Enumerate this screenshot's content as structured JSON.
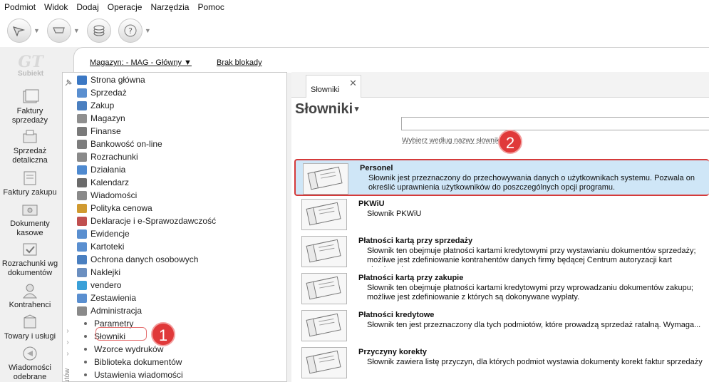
{
  "menubar": {
    "items": [
      "Podmiot",
      "Widok",
      "Dodaj",
      "Operacje",
      "Narzędzia",
      "Pomoc"
    ]
  },
  "toolbar": {
    "buttons": [
      "cursor-icon",
      "cart-icon",
      "coins-icon",
      "help-icon"
    ]
  },
  "logo": {
    "mark": "GT",
    "text": "Subiekt"
  },
  "leftbar": {
    "items": [
      {
        "label": "Faktury sprzedaży",
        "icon": "invoice-stack-icon"
      },
      {
        "label": "Sprzedaż detaliczna",
        "icon": "cash-register-icon"
      },
      {
        "label": "Faktury zakupu",
        "icon": "purchase-invoice-icon"
      },
      {
        "label": "Dokumenty kasowe",
        "icon": "cash-documents-icon"
      },
      {
        "label": "Rozrachunki wg dokumentów",
        "icon": "settlements-icon"
      },
      {
        "label": "Kontrahenci",
        "icon": "person-icon"
      },
      {
        "label": "Towary i usługi",
        "icon": "goods-icon"
      },
      {
        "label": "Wiadomości odebrane",
        "icon": "message-icon"
      }
    ]
  },
  "strip": {
    "magazyn": "Magazyn: - MAG - Główny",
    "blokada": "Brak blokady"
  },
  "nav": {
    "items": [
      {
        "label": "Strona główna",
        "color": "#3b78c4"
      },
      {
        "label": "Sprzedaż",
        "color": "#5a8fd0"
      },
      {
        "label": "Zakup",
        "color": "#4a7fc0"
      },
      {
        "label": "Magazyn",
        "color": "#8f8f8f"
      },
      {
        "label": "Finanse",
        "color": "#7a7a7a"
      },
      {
        "label": "Bankowość on-line",
        "color": "#7d7d7d"
      },
      {
        "label": "Rozrachunki",
        "color": "#8a8a8a"
      },
      {
        "label": "Działania",
        "color": "#4f8ad0"
      },
      {
        "label": "Kalendarz",
        "color": "#6b6b6b"
      },
      {
        "label": "Wiadomości",
        "color": "#8a8a8a"
      },
      {
        "label": "Polityka cenowa",
        "color": "#d09a30"
      },
      {
        "label": "Deklaracje i e-Sprawozdawczość",
        "color": "#c05050"
      },
      {
        "label": "Ewidencje",
        "color": "#5a8fd0"
      },
      {
        "label": "Kartoteki",
        "color": "#5a8fd0"
      },
      {
        "label": "Ochrona danych osobowych",
        "color": "#4a7fc0"
      },
      {
        "label": "Naklejki",
        "color": "#6b8fc0"
      },
      {
        "label": "vendero",
        "color": "#3aa0d8"
      },
      {
        "label": "Zestawienia",
        "color": "#5a8fd0"
      },
      {
        "label": "Administracja",
        "color": "#8a8a8a"
      }
    ],
    "subitems": [
      "Parametry",
      "Słowniki",
      "Wzorce wydruków",
      "Biblioteka dokumentów",
      "Ustawienia wiadomości"
    ],
    "vertical_label": "utów"
  },
  "content": {
    "tab_label": "Słowniki",
    "title": "Słowniki",
    "search_hint": "Wybierz według nazwy słownika",
    "rows": [
      {
        "title": "Personel",
        "desc": "Słownik jest przeznaczony do przechowywania danych o użytkownikach systemu. Pozwala on określić uprawnienia użytkowników do poszczególnych opcji programu."
      },
      {
        "title": "PKWiU",
        "desc": "Słownik PKWiU"
      },
      {
        "title": "Płatności kartą przy sprzedaży",
        "desc": "Słownik ten obejmuje płatności kartami kredytowymi przy wystawianiu dokumentów sprzedaży; możliwe jest zdefiniowanie kontrahentów danych firmy będącej Centrum autoryzacji kart płatniczych."
      },
      {
        "title": "Płatności kartą przy zakupie",
        "desc": "Słownik ten obejmuje płatności kartami kredytowymi przy wprowadzaniu dokumentów zakupu; możliwe jest zdefiniowanie z których są dokonywane wypłaty."
      },
      {
        "title": "Płatności kredytowe",
        "desc": "Słownik ten jest przeznaczony dla tych podmiotów, które prowadzą sprzedaż ratalną. Wymaga..."
      },
      {
        "title": "Przyczyny korekty",
        "desc": "Słownik zawiera listę przyczyn, dla których podmiot wystawia dokumenty korekt faktur sprzedaży"
      }
    ]
  },
  "annotations": {
    "badge1": "1",
    "badge2": "2",
    "accent": "#e0393a"
  }
}
